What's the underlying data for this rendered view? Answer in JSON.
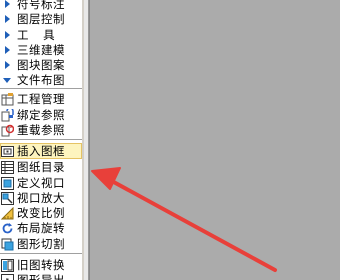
{
  "sidebar": {
    "tree": [
      {
        "label": "符号标注"
      },
      {
        "label": "图层控制"
      },
      {
        "label": "工    具"
      },
      {
        "label": "三维建模"
      },
      {
        "label": "图块图案"
      },
      {
        "label": "文件布图"
      }
    ],
    "items_group1": [
      {
        "label": "工程管理",
        "icon": "project-icon"
      },
      {
        "label": "绑定参照",
        "icon": "bind-ref-icon"
      },
      {
        "label": "重载参照",
        "icon": "reload-ref-icon"
      }
    ],
    "items_group2": [
      {
        "label": "插入图框",
        "icon": "frame-icon"
      },
      {
        "label": "图纸目录",
        "icon": "catalog-icon"
      },
      {
        "label": "定义视口",
        "icon": "viewport-icon"
      },
      {
        "label": "视口放大",
        "icon": "viewport-zoom-icon"
      },
      {
        "label": "改变比例",
        "icon": "scale-icon"
      },
      {
        "label": "布局旋转",
        "icon": "rotate-icon"
      },
      {
        "label": "图形切割",
        "icon": "cut-icon"
      }
    ],
    "items_group3": [
      {
        "label": "旧图转换",
        "icon": "convert-icon"
      },
      {
        "label": "图形导出",
        "icon": "export-icon"
      }
    ]
  },
  "colors": {
    "highlight_bg": "#fdf4bf",
    "arrow": "#e8403a",
    "canvas": "#ababab"
  }
}
